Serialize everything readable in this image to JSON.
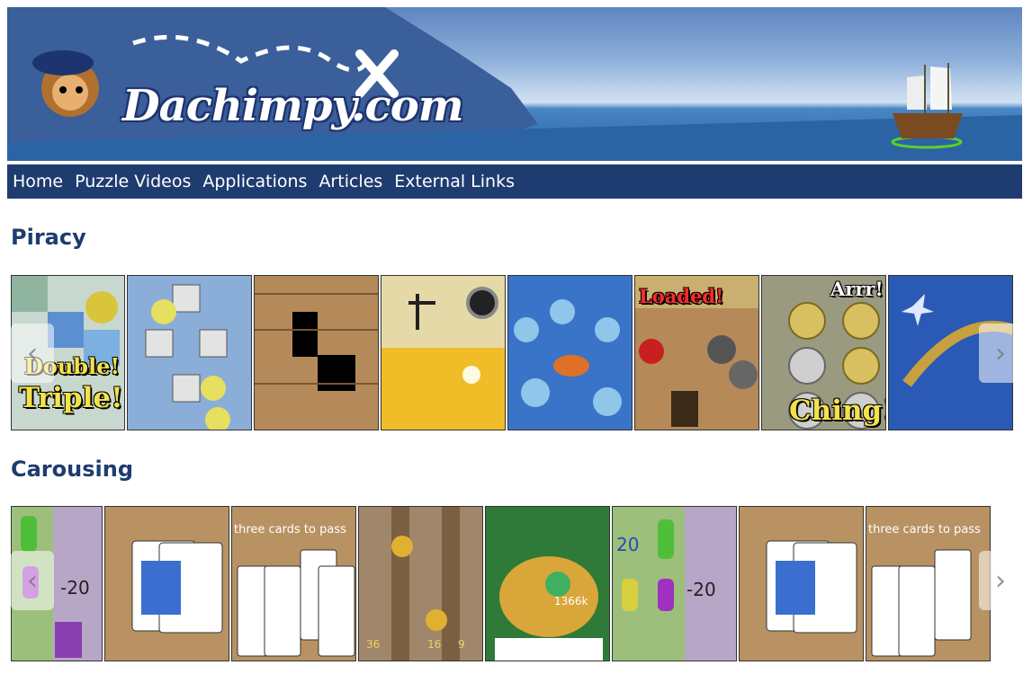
{
  "site": {
    "logo_text": "Dachimpy.com"
  },
  "nav": [
    {
      "label": "Home"
    },
    {
      "label": "Puzzle Videos"
    },
    {
      "label": "Applications"
    },
    {
      "label": "Articles"
    },
    {
      "label": "External Links"
    }
  ],
  "sections": [
    {
      "title": "Piracy",
      "tiles": [
        {
          "caption_1": "Double!",
          "caption_2": "Triple!"
        },
        {},
        {},
        {},
        {},
        {
          "caption_1": "Loaded!"
        },
        {
          "caption_1": "Arrr!",
          "caption_2": "Ching!"
        },
        {}
      ]
    },
    {
      "title": "Carousing",
      "tiles": [
        {
          "caption_1": "-20"
        },
        {},
        {
          "caption_1": "three cards to pass"
        },
        {
          "caption_1": "36",
          "caption_2": "16",
          "caption_3": "9"
        },
        {
          "caption_1": "1366k"
        },
        {
          "caption_1": "20",
          "caption_2": "-20"
        },
        {},
        {
          "caption_1": "three cards to pass"
        }
      ]
    }
  ],
  "icons": {
    "prev": "chevron-left-icon",
    "next": "chevron-right-icon"
  }
}
